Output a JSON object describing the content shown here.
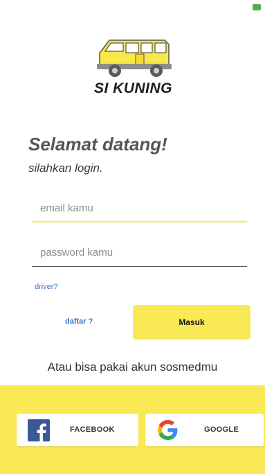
{
  "status_bar": {
    "left_text": "",
    "right_text": ""
  },
  "brand": {
    "name": "SI KUNING"
  },
  "welcome": {
    "title": "Selamat datang!",
    "subtitle": "silahkan login."
  },
  "form": {
    "email_placeholder": "email kamu",
    "password_placeholder": "password kamu",
    "driver_link": "driver?",
    "register_link": "daftar ?",
    "login_button": "Masuk"
  },
  "social": {
    "title": "Atau bisa pakai akun sosmedmu",
    "facebook_label": "FACEBOOK",
    "google_label": "GOOGLE"
  },
  "colors": {
    "accent_yellow": "#f9ea55",
    "link_blue": "#3a6fc4",
    "facebook_blue": "#3b5998"
  }
}
